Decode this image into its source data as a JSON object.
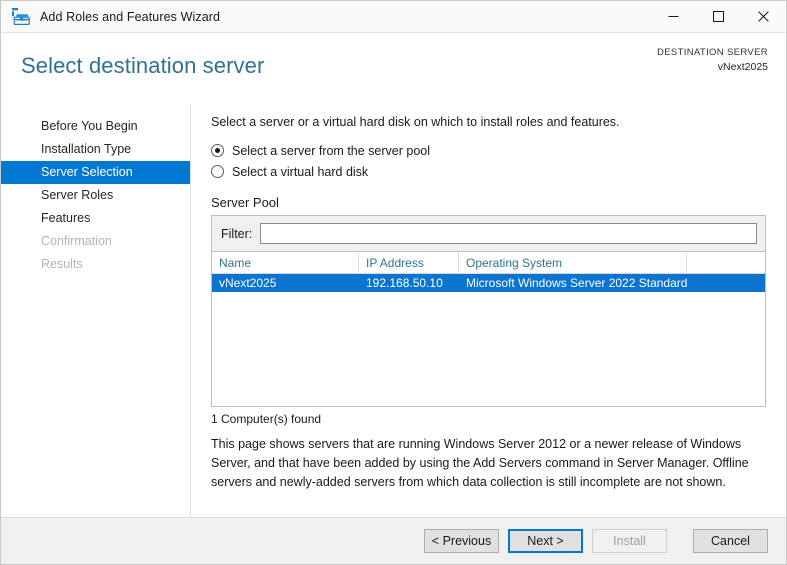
{
  "window": {
    "title": "Add Roles and Features Wizard",
    "icon": "server-manager-toolbox-icon",
    "minimize_label": "–",
    "maximize_label": "☐",
    "close_label": "✕"
  },
  "header": {
    "page_title": "Select destination server",
    "destination_label": "DESTINATION SERVER",
    "destination_value": "vNext2025"
  },
  "sidebar": {
    "items": [
      {
        "label": "Before You Begin",
        "state": "normal"
      },
      {
        "label": "Installation Type",
        "state": "normal"
      },
      {
        "label": "Server Selection",
        "state": "selected"
      },
      {
        "label": "Server Roles",
        "state": "normal"
      },
      {
        "label": "Features",
        "state": "normal"
      },
      {
        "label": "Confirmation",
        "state": "disabled"
      },
      {
        "label": "Results",
        "state": "disabled"
      }
    ]
  },
  "main": {
    "intro": "Select a server or a virtual hard disk on which to install roles and features.",
    "radios": [
      {
        "label": "Select a server from the server pool",
        "checked": true
      },
      {
        "label": "Select a virtual hard disk",
        "checked": false
      }
    ],
    "server_pool_label": "Server Pool",
    "filter": {
      "label": "Filter:",
      "value": "",
      "placeholder": ""
    },
    "table": {
      "columns": [
        "Name",
        "IP Address",
        "Operating System",
        ""
      ],
      "rows": [
        {
          "cells": [
            "vNext2025",
            "192.168.50.10",
            "Microsoft Windows Server 2022 Standard",
            ""
          ],
          "selected": true
        }
      ]
    },
    "found_text": "1 Computer(s) found",
    "description": "This page shows servers that are running Windows Server 2012 or a newer release of Windows Server, and that have been added by using the Add Servers command in Server Manager. Offline servers and newly-added servers from which data collection is still incomplete are not shown."
  },
  "footer": {
    "previous_label": "< Previous",
    "next_label": "Next >",
    "install_label": "Install",
    "cancel_label": "Cancel"
  },
  "colors": {
    "accent": "#0078d4",
    "row_selection": "#0c74ce",
    "title_teal": "#2f7391",
    "header_link": "#2f7391"
  }
}
